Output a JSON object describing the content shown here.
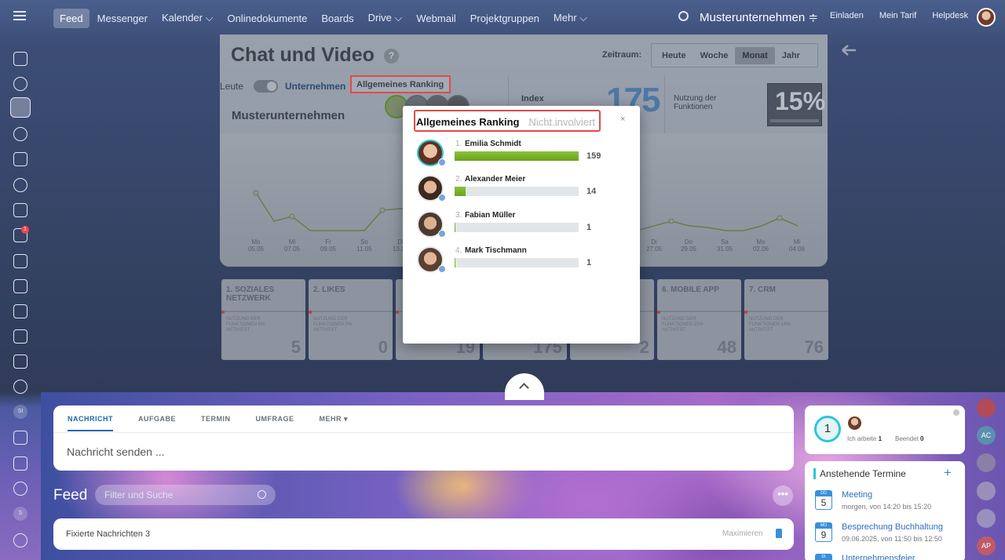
{
  "topbar": {
    "nav": [
      "Feed",
      "Messenger",
      "Kalender ⌵",
      "Onlinedokumente",
      "Boards",
      "Drive ⌵",
      "Webmail",
      "Projektgruppen",
      "Mehr ⌵"
    ],
    "company": "Musterunternehmen ≑",
    "links": [
      "Einladen",
      "Mein Tarif",
      "Helpdesk"
    ]
  },
  "sidebar": {
    "task_badge": "1",
    "si_label": "SI",
    "s_label": "S"
  },
  "dashboard": {
    "title": "Chat und Video",
    "help": "?",
    "zeitraum": "Zeitraum:",
    "periods": [
      "Heute",
      "Woche",
      "Monat",
      "Jahr"
    ],
    "leute": "Leute",
    "unternehmen": "Unternehmen",
    "ranking_tab": "Allgemeines Ranking",
    "company_name": "Musterunternehmen",
    "index_label": "Index",
    "index_value": "175",
    "nutzung": "Nutzung der Funktionen",
    "nutzung_pct": "15%",
    "x_labels": [
      "Mo\n05.05",
      "Mi\n07.05",
      "Fr\n09.05",
      "So\n11.05",
      "Di\n13.05",
      "Di\n27.05",
      "Do\n29.05",
      "Sa\n31.05",
      "Mo\n02.06",
      "Mi\n04.06"
    ]
  },
  "cards": [
    {
      "title": "1. SOZIALES NETZWERK",
      "sub": "NUTZUNG DER FUNKTIONEN 6% AKTIVITÄT",
      "value": "5"
    },
    {
      "title": "2. LIKES",
      "sub": "NUTZUNG DER FUNKTIONEN 0% AKTIVITÄT",
      "value": "0"
    },
    {
      "title": "",
      "sub": "",
      "value": "19"
    },
    {
      "title": "",
      "sub": "",
      "value": "175"
    },
    {
      "title": "",
      "sub": "",
      "value": "2"
    },
    {
      "title": "6. MOBILE APP",
      "sub": "NUTZUNG DER FUNKTIONEN 21% AKTIVITÄT",
      "value": "48"
    },
    {
      "title": "7. CRM",
      "sub": "NUTZUNG DER FUNKTIONEN 14% AKTIVITÄT",
      "value": "76"
    }
  ],
  "popup": {
    "tab_active": "Allgemeines Ranking",
    "tab_inactive": "Nicht involviert",
    "close": "×",
    "ranking": [
      {
        "num": "1.",
        "name": "Emilia Schmidt",
        "value": "159",
        "fraction": 1.0
      },
      {
        "num": "2.",
        "name": "Alexander Meier",
        "value": "14",
        "fraction": 0.088
      },
      {
        "num": "3.",
        "name": "Fabian Müller",
        "value": "1",
        "fraction": 0.006
      },
      {
        "num": "4.",
        "name": "Mark Tischmann",
        "value": "1",
        "fraction": 0.006
      }
    ]
  },
  "composer": {
    "tabs": [
      "NACHRICHT",
      "AUFGABE",
      "TERMIN",
      "UMFRAGE",
      "MEHR ▾"
    ],
    "placeholder": "Nachricht senden ..."
  },
  "feed": {
    "title": "Feed",
    "filter_placeholder": "Filter und Suche",
    "more": "•••",
    "pinned": "Fixierte Nachrichten 3",
    "maximize": "Maximieren"
  },
  "work_widget": {
    "count": "1",
    "working_label": "Ich arbeite",
    "working_count": "1",
    "done_label": "Beendet",
    "done_count": "0"
  },
  "events": {
    "title": "Anstehende Termine",
    "plus": "+",
    "items": [
      {
        "dow": "DO",
        "day": "5",
        "name": "Meeting",
        "time": "morgen, von 14:20 bis 15:20"
      },
      {
        "dow": "MO",
        "day": "9",
        "name": "Besprechung Buchhaltung",
        "time": "09.06.2025, von 11:50 bis 12:50"
      },
      {
        "dow": "DI",
        "day": "",
        "name": "Unternehmensfeier",
        "time": ""
      }
    ]
  },
  "rail": {
    "ac": "AC",
    "ap": "AP"
  },
  "colors": {
    "accent": "#2066b0",
    "highlight": "#e14a4a",
    "bar_green": "#7ab52a",
    "teal": "#2fc5d8"
  }
}
